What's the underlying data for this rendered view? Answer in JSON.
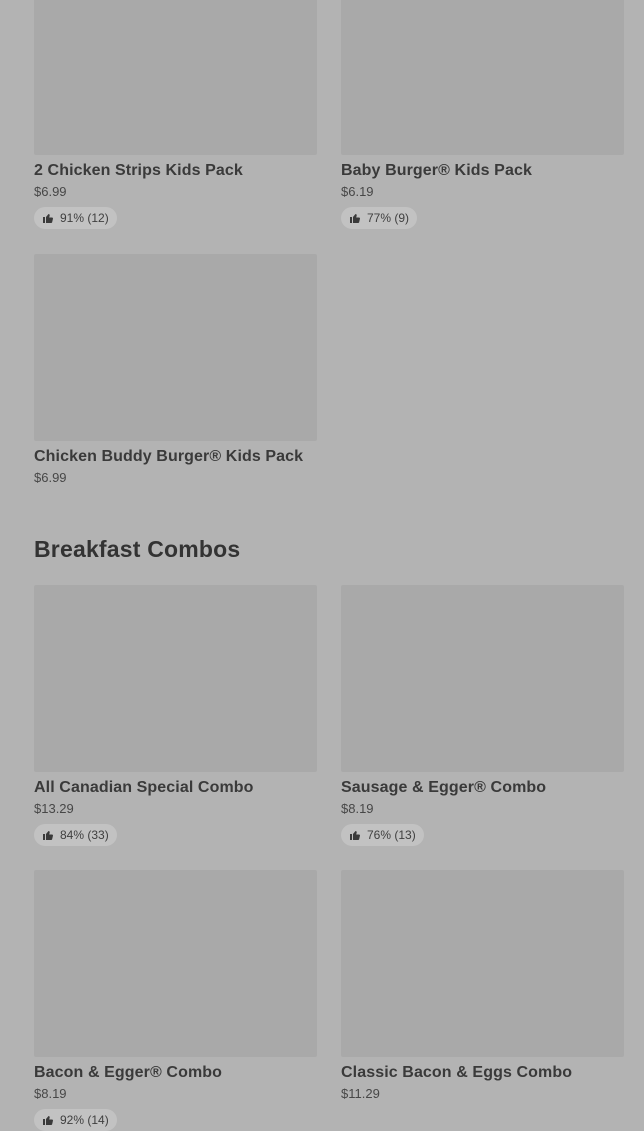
{
  "kids_section": {
    "items": [
      {
        "name": "2 Chicken Strips Kids  Pack",
        "price": "$6.99",
        "rating": "91% (12)"
      },
      {
        "name": "Baby Burger® Kids  Pack",
        "price": "$6.19",
        "rating": "77% (9)"
      },
      {
        "name": "Chicken Buddy Burger® Kids  Pack",
        "price": "$6.99"
      }
    ]
  },
  "breakfast_section": {
    "title": "Breakfast Combos",
    "items": [
      {
        "name": "All Canadian Special Combo",
        "price": "$13.29",
        "rating": "84% (33)"
      },
      {
        "name": "Sausage & Egger® Combo",
        "price": "$8.19",
        "rating": "76% (13)"
      },
      {
        "name": "Bacon & Egger® Combo",
        "price": "$8.19",
        "rating": "92% (14)"
      },
      {
        "name": "Classic Bacon & Eggs Combo",
        "price": "$11.29"
      }
    ]
  },
  "icons": {
    "rating": "thumbs-up-icon"
  }
}
